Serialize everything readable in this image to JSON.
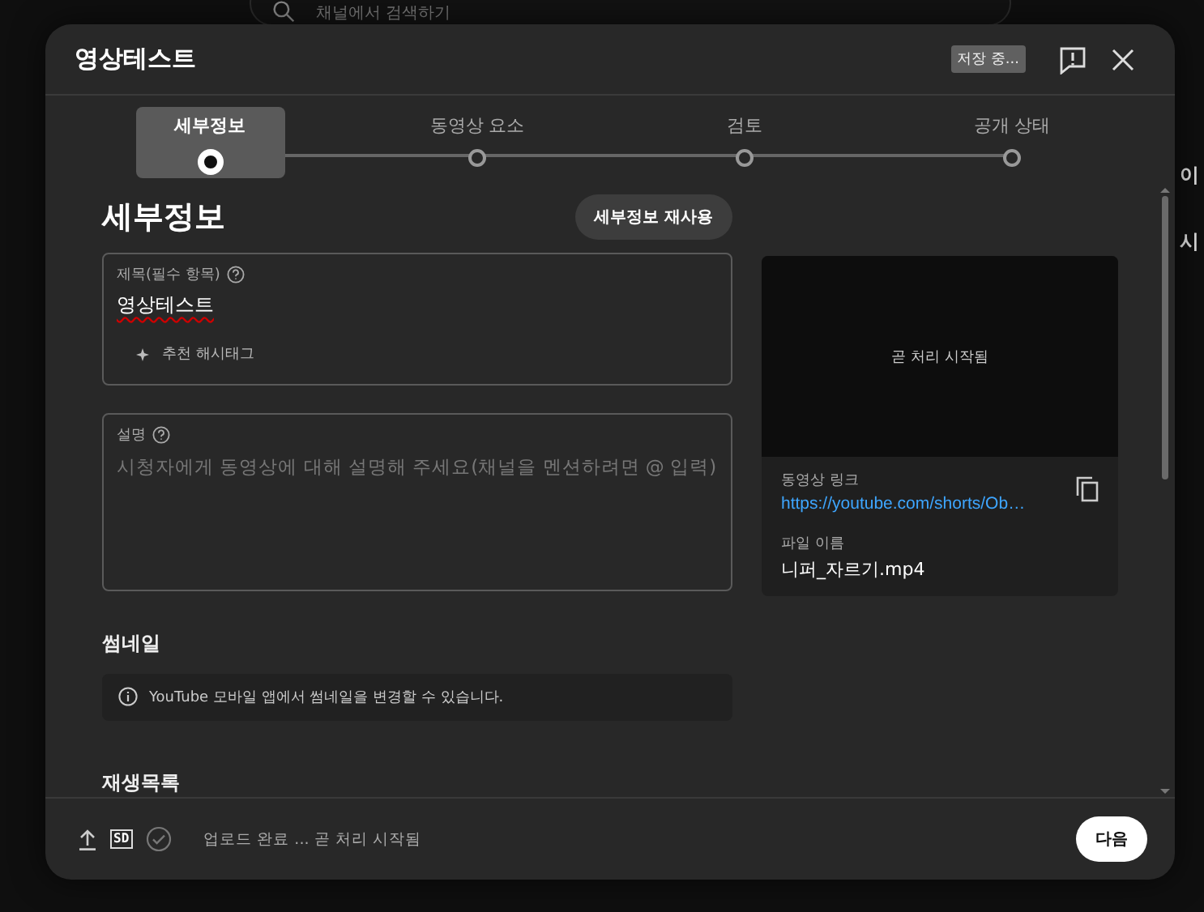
{
  "background": {
    "search_placeholder": "채널에서 검색하기",
    "side_headings": [
      "이",
      "시"
    ]
  },
  "dialog": {
    "title": "영상테스트",
    "save_status": "저장 중..."
  },
  "steps": [
    {
      "label": "세부정보",
      "selected": true
    },
    {
      "label": "동영상 요소",
      "selected": false
    },
    {
      "label": "검토",
      "selected": false
    },
    {
      "label": "공개 상태",
      "selected": false
    }
  ],
  "section_title": "세부정보",
  "reuse_button": "세부정보 재사용",
  "title_field": {
    "label": "제목(필수 항목)",
    "value": "영상테스트",
    "hashtag_button": "추천 해시태그"
  },
  "description_field": {
    "label": "설명",
    "placeholder": "시청자에게 동영상에 대해 설명해 주세요(채널을 멘션하려면 @ 입력)"
  },
  "video_card": {
    "status": "곧 처리 시작됨",
    "link_label": "동영상 링크",
    "link": "https://youtube.com/shorts/Ob…",
    "filename_label": "파일 이름",
    "filename": "니퍼_자르기.mp4"
  },
  "thumbnail": {
    "heading": "썸네일",
    "notice": "YouTube 모바일 앱에서 썸네일을 변경할 수 있습니다."
  },
  "playlist": {
    "heading": "재생목록"
  },
  "footer": {
    "quality_badge": "SD",
    "status": "업로드 완료 ... 곧 처리 시작됨",
    "next_button": "다음"
  }
}
